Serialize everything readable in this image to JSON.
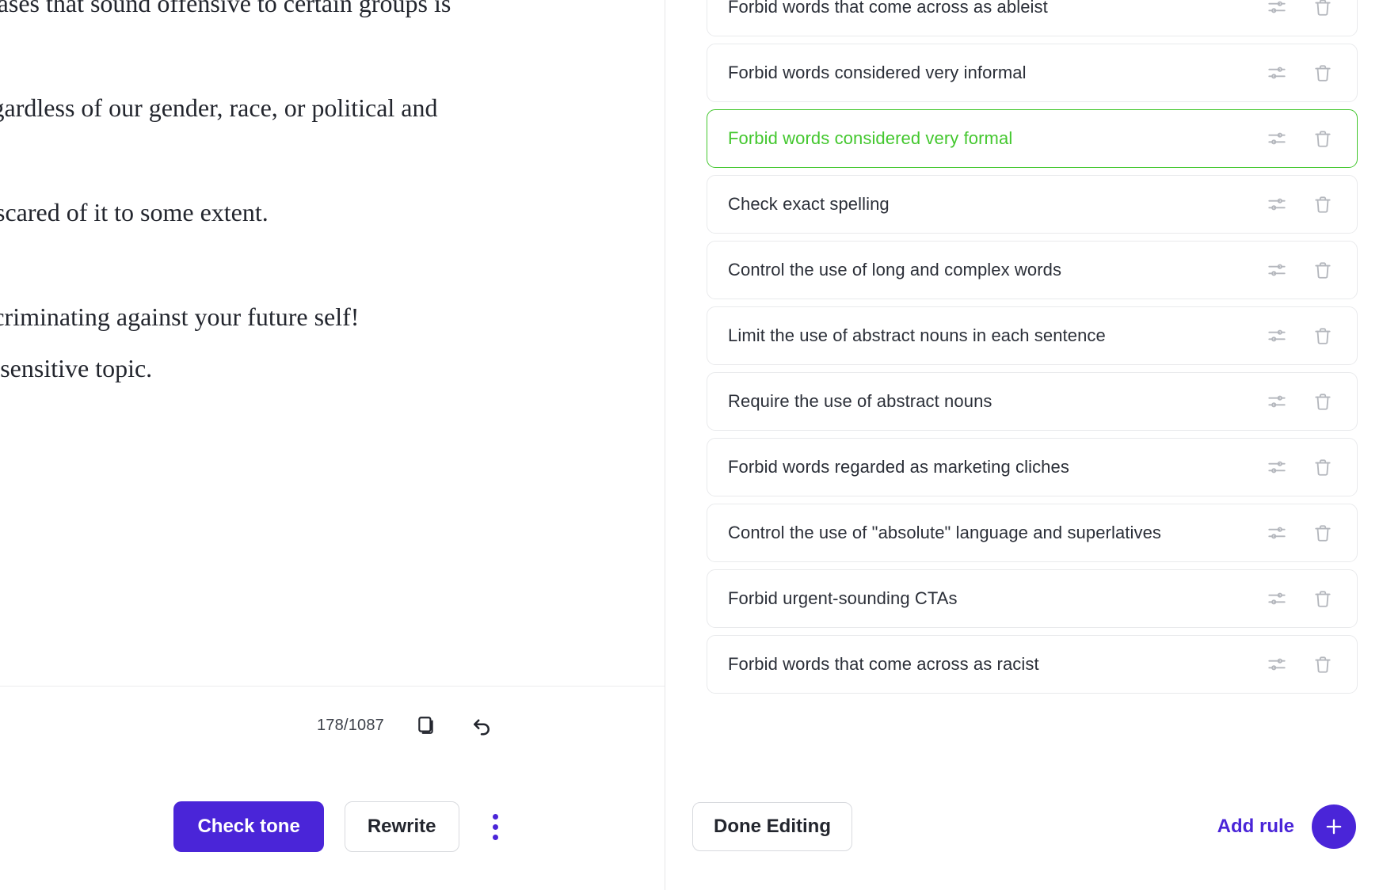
{
  "document": {
    "lines": [
      "phrases that sound offensive to certain groups is",
      "Regardless of our gender, race, or political and",
      "all scared of it to some extent.",
      "discriminating against your future self!",
      "n a sensitive topic."
    ],
    "counter": "178/1087",
    "copy_icon": "copy-icon",
    "undo_icon": "undo-icon",
    "actions": {
      "check_tone": "Check tone",
      "rewrite": "Rewrite",
      "more_icon": "kebab-menu-icon"
    }
  },
  "rules_panel": {
    "rules": [
      {
        "label": "Forbid words that come across as ableist",
        "active": false
      },
      {
        "label": "Forbid words considered very informal",
        "active": false
      },
      {
        "label": "Forbid words considered very formal",
        "active": true
      },
      {
        "label": "Check exact spelling",
        "active": false
      },
      {
        "label": "Control the use of long and complex words",
        "active": false
      },
      {
        "label": "Limit the use of abstract nouns in each sentence",
        "active": false
      },
      {
        "label": "Require the use of abstract nouns",
        "active": false
      },
      {
        "label": "Forbid words regarded as marketing cliches",
        "active": false
      },
      {
        "label": "Control the use of \"absolute\" language and superlatives",
        "active": false
      },
      {
        "label": "Forbid urgent-sounding CTAs",
        "active": false
      },
      {
        "label": "Forbid words that come across as racist",
        "active": false
      }
    ],
    "row_icons": {
      "settings": "sliders-icon",
      "delete": "trash-icon"
    },
    "actions": {
      "done_editing": "Done Editing",
      "add_rule": "Add rule",
      "add_icon": "plus-icon"
    }
  },
  "colors": {
    "accent_purple": "#4A25D8",
    "active_green": "#43C72E",
    "card_border": "#e9eaec",
    "icon_grey": "#b4b7bd",
    "text_dark": "#23262e"
  }
}
